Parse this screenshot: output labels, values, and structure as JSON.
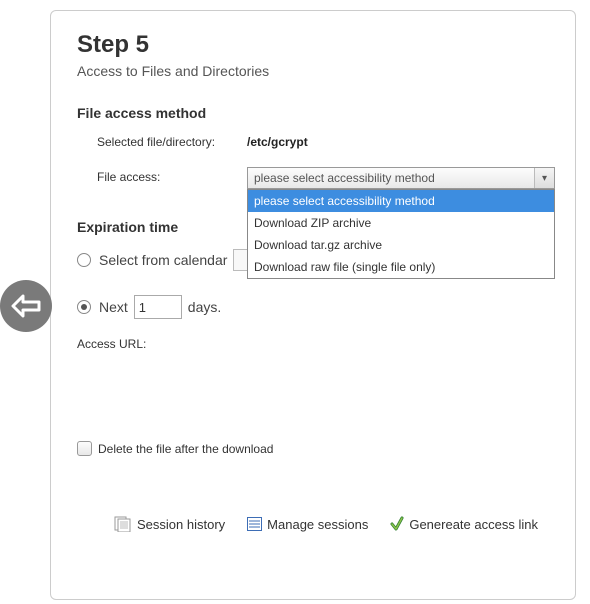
{
  "step": {
    "title": "Step 5",
    "subtitle": "Access to Files and Directories"
  },
  "file_access": {
    "section_title": "File access method",
    "selected_label": "Selected file/directory:",
    "selected_value": "/etc/gcrypt",
    "access_label": "File access:",
    "dropdown_value": "please select accessibility method",
    "options": {
      "o0": "please select accessibility method",
      "o1": "Download ZIP archive",
      "o2": "Download tar.gz archive",
      "o3": "Download raw file (single file only)"
    }
  },
  "expiration": {
    "section_title": "Expiration time",
    "calendar_label": "Select from calendar",
    "next_prefix": "Next",
    "next_days_value": "1",
    "next_suffix": "days."
  },
  "access_url_label": "Access URL:",
  "delete_after_label": "Delete the file after the download",
  "footer": {
    "session_history": "Session history",
    "manage_sessions": "Manage sessions",
    "generate_link": "Genereate access link"
  }
}
